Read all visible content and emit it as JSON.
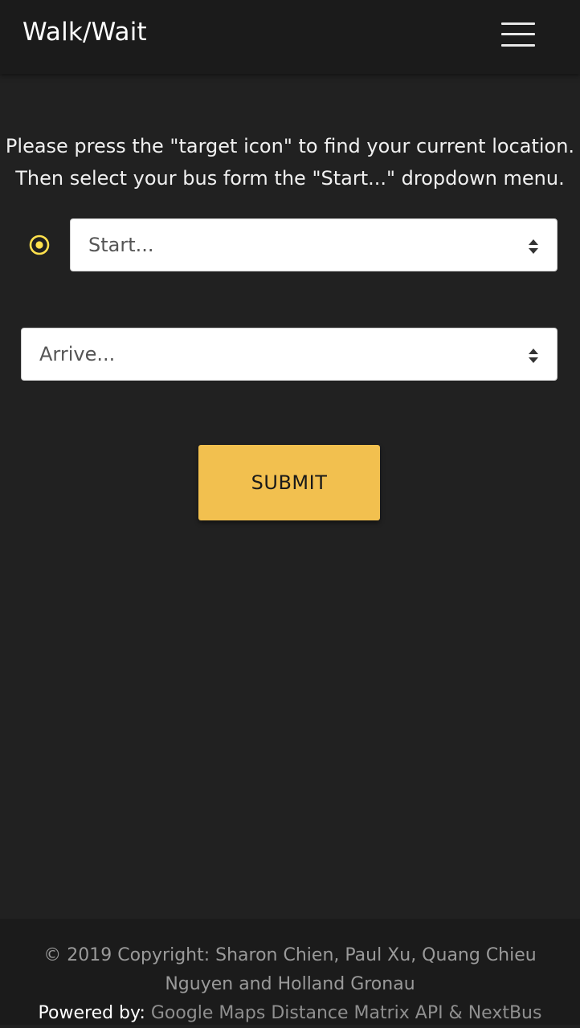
{
  "navbar": {
    "brand": "Walk/Wait",
    "menu_icon": "hamburger-menu-icon"
  },
  "instructions": {
    "line1": "Please press the \"target icon\" to find your current location.",
    "line2": "Then select your bus form the \"Start...\" dropdown menu."
  },
  "form": {
    "target_icon": "target-icon",
    "start_select": "Start...",
    "arrive_select": "Arrive...",
    "submit_label": "SUBMIT"
  },
  "footer": {
    "copyright": "© 2019 Copyright: Sharon Chien, Paul Xu, Quang Chieu Nguyen and Holland Gronau",
    "powered_label": "Powered by:",
    "powered_links": "Google Maps Distance Matrix API & NextBus"
  },
  "colors": {
    "background": "#212121",
    "navbar": "#1b1b1b",
    "accent": "#f2c04f",
    "target_icon": "#ffe14d"
  }
}
